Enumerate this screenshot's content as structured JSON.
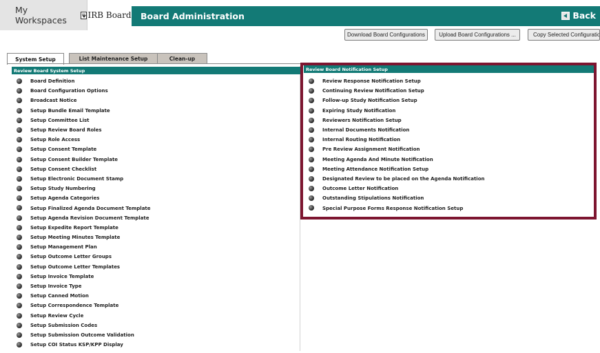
{
  "header": {
    "workspaces_label": "My Workspaces",
    "irb_tab_label": "IRB Board",
    "title": "Board Administration",
    "back_label": "Back"
  },
  "actions": {
    "download": "Download Board Configurations",
    "upload": "Upload Board Configurations ...",
    "copy": "Copy Selected Configuration"
  },
  "tabs": [
    {
      "label": "System Setup"
    },
    {
      "label": "List Maintenance Setup"
    },
    {
      "label": "Clean-up"
    }
  ],
  "left_panel": {
    "header": "Review Board System Setup",
    "items": [
      "Board Definition",
      "Board Configuration Options",
      "Broadcast Notice",
      "Setup Bundle Email Template",
      "Setup Committee List",
      "Setup Review Board Roles",
      "Setup Role Access",
      "Setup Consent Template",
      "Setup Consent Builder Template",
      "Setup Consent Checklist",
      "Setup Electronic Document Stamp",
      "Setup Study Numbering",
      "Setup Agenda Categories",
      "Setup Finalized Agenda Document Template",
      "Setup Agenda Revision Document Template",
      "Setup Expedite Report Template",
      "Setup Meeting Minutes Template",
      "Setup Management Plan",
      "Setup Outcome Letter Groups",
      "Setup Outcome Letter Templates",
      "Setup Invoice Template",
      "Setup Invoice Type",
      "Setup Canned Motion",
      "Setup Correspondence Template",
      "Setup Review Cycle",
      "Setup Submission Codes",
      "Setup Submission Outcome Validation",
      "Setup COI Status KSP/KPP Display"
    ]
  },
  "right_panel": {
    "header": "Review Board  Notification Setup",
    "items": [
      "Review Response Notification Setup",
      "Continuing Review Notification Setup",
      "Follow-up Study Notification Setup",
      "Expiring Study Notification",
      "Reviewers Notification Setup",
      "Internal Documents Notification",
      "Internal Routing Notification",
      "Pre Review Assignment Notification",
      "Meeting Agenda And Minute Notification",
      "Meeting Attendance Notification Setup",
      "Designated Review to be placed on the Agenda Notification",
      "Outcome Letter Notification",
      "Outstanding Stipulations Notification",
      "Special Purpose Forms Response Notification Setup"
    ]
  },
  "colors": {
    "teal": "#137a76",
    "highlight": "#7d1530",
    "inactive_tab": "#c9c3bc"
  }
}
